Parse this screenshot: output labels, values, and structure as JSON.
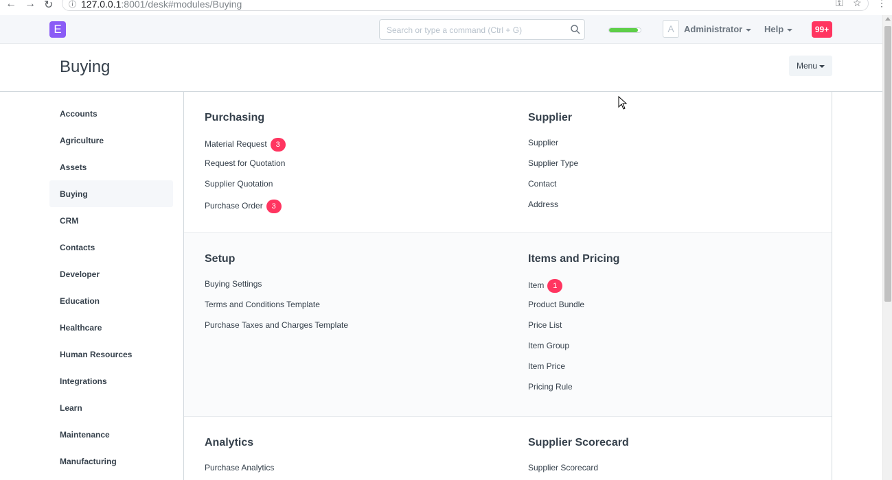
{
  "browser": {
    "url_host": "127.0.0.1",
    "url_rest": ":8001/desk#modules/Buying"
  },
  "navbar": {
    "logo_letter": "E",
    "search_placeholder": "Search or type a command (Ctrl + G)",
    "progress_fraction": 0.92,
    "avatar_letter": "A",
    "user_label": "Administrator",
    "help_label": "Help",
    "notifications_label": "99+"
  },
  "page": {
    "title": "Buying",
    "menu_label": "Menu"
  },
  "sidebar": {
    "items": [
      {
        "label": "Accounts"
      },
      {
        "label": "Agriculture"
      },
      {
        "label": "Assets"
      },
      {
        "label": "Buying"
      },
      {
        "label": "CRM"
      },
      {
        "label": "Contacts"
      },
      {
        "label": "Developer"
      },
      {
        "label": "Education"
      },
      {
        "label": "Healthcare"
      },
      {
        "label": "Human Resources"
      },
      {
        "label": "Integrations"
      },
      {
        "label": "Learn"
      },
      {
        "label": "Maintenance"
      },
      {
        "label": "Manufacturing"
      }
    ],
    "active": "Buying"
  },
  "sections": [
    {
      "left": {
        "title": "Purchasing",
        "links": [
          {
            "label": "Material Request",
            "badge": "3"
          },
          {
            "label": "Request for Quotation"
          },
          {
            "label": "Supplier Quotation"
          },
          {
            "label": "Purchase Order",
            "badge": "3"
          }
        ]
      },
      "right": {
        "title": "Supplier",
        "links": [
          {
            "label": "Supplier"
          },
          {
            "label": "Supplier Type"
          },
          {
            "label": "Contact"
          },
          {
            "label": "Address"
          }
        ]
      }
    },
    {
      "left": {
        "title": "Setup",
        "links": [
          {
            "label": "Buying Settings"
          },
          {
            "label": "Terms and Conditions Template"
          },
          {
            "label": "Purchase Taxes and Charges Template"
          }
        ]
      },
      "right": {
        "title": "Items and Pricing",
        "links": [
          {
            "label": "Item",
            "badge": "1"
          },
          {
            "label": "Product Bundle"
          },
          {
            "label": "Price List"
          },
          {
            "label": "Item Group"
          },
          {
            "label": "Item Price"
          },
          {
            "label": "Pricing Rule"
          }
        ]
      }
    },
    {
      "left": {
        "title": "Analytics",
        "links": [
          {
            "label": "Purchase Analytics"
          }
        ]
      },
      "right": {
        "title": "Supplier Scorecard",
        "links": [
          {
            "label": "Supplier Scorecard"
          }
        ]
      }
    }
  ],
  "colors": {
    "accent": "#8b5cf6",
    "badge": "#ff3560",
    "progress": "#5ece48"
  }
}
